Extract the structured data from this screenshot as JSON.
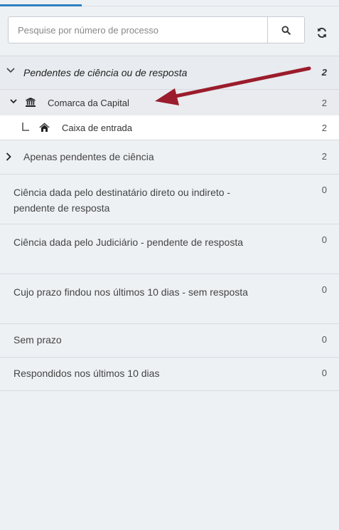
{
  "search": {
    "placeholder": "Pesquise por número de processo",
    "search_icon": "search-icon",
    "refresh_icon": "refresh-icon"
  },
  "list": {
    "main": {
      "label": "Pendentes de ciência ou de resposta",
      "count": "2",
      "icon": "chevron-down-icon"
    },
    "court": {
      "label": "Comarca da Capital",
      "count": "2",
      "icon": "bank-icon"
    },
    "inbox": {
      "label": "Caixa de entrada",
      "count": "2",
      "icon": "home-icon"
    },
    "only_pending": {
      "label": "Apenas pendentes de ciência",
      "count": "2",
      "icon": "chevron-right-icon"
    },
    "items": [
      {
        "label": "Ciência dada pelo destinatário direto ou indireto - pendente de resposta",
        "count": "0"
      },
      {
        "label": "Ciência dada pelo Judiciário - pendente de resposta",
        "count": "0"
      },
      {
        "label": "Cujo prazo findou nos últimos 10 dias - sem resposta",
        "count": "0"
      },
      {
        "label": "Sem prazo",
        "count": "0"
      },
      {
        "label": "Respondidos nos últimos 10 dias",
        "count": "0"
      }
    ]
  },
  "annotation": {
    "arrow_color": "#9b1c2c"
  }
}
